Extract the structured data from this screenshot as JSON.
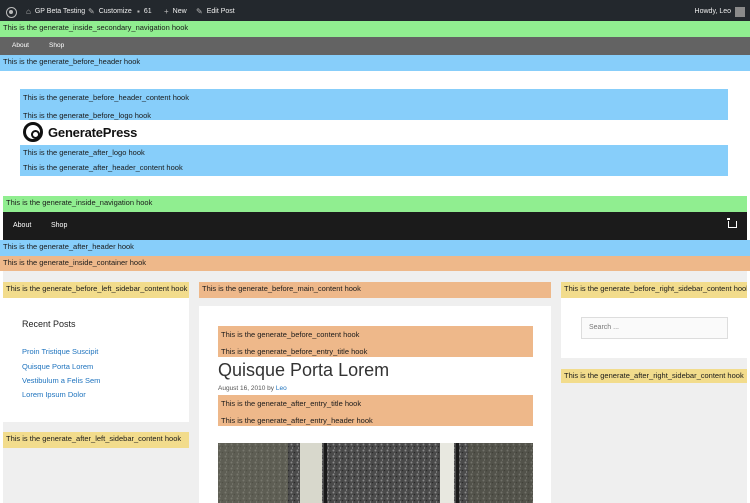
{
  "admin_bar": {
    "site_name": "GP Beta Testing",
    "customize": "Customize",
    "comments_count": "61",
    "new": "New",
    "edit_post": "Edit Post",
    "howdy": "Howdy, Leo"
  },
  "hooks": {
    "inside_secondary_navigation": "This is the generate_inside_secondary_navigation hook",
    "before_header": "This is the generate_before_header hook",
    "before_header_content": "This is the generate_before_header_content hook",
    "before_logo": "This is the generate_before_logo hook",
    "after_logo": "This is the generate_after_logo hook",
    "after_header_content": "This is the generate_after_header_content hook",
    "inside_navigation": "This is the generate_inside_navigation hook",
    "after_header": "This is the generate_after_header hook",
    "inside_container": "This is the generate_inside_container hook",
    "before_left_sidebar_content": "This is the generate_before_left_sidebar_content hook",
    "before_main_content": "This is the generate_before_main_content hook",
    "before_right_sidebar_content": "This is the generate_before_right_sidebar_content hook",
    "before_content": "This is the generate_before_content hook",
    "before_entry_title": "This is the generate_before_entry_title hook",
    "after_entry_title": "This is the generate_after_entry_title hook",
    "after_entry_header": "This is the generate_after_entry_header hook",
    "after_right_sidebar_content": "This is the generate_after_right_sidebar_content hook",
    "after_left_sidebar_content": "This is the generate_after_left_sidebar_content hook"
  },
  "secondary_nav": {
    "items": [
      "About",
      "Shop"
    ]
  },
  "logo": {
    "text": "GeneratePress"
  },
  "main_nav": {
    "items": [
      "About",
      "Shop"
    ]
  },
  "sidebar_left": {
    "title": "Recent Posts",
    "posts": [
      "Proin Tristique Suscipit",
      "Quisque Porta Lorem",
      "Vestibulum a Felis Sem",
      "Lorem Ipsum Dolor"
    ]
  },
  "sidebar_right": {
    "search_placeholder": "Search ..."
  },
  "post": {
    "title": "Quisque Porta Lorem",
    "date": "August 16, 2010",
    "by": "by",
    "author": "Leo"
  },
  "colors": {
    "hook_green": "#90ee90",
    "hook_blue": "#87cefa",
    "hook_orange": "#eeb88a",
    "hook_yellow": "#f2dc8c",
    "admin_bar": "#23282d",
    "navigation": "#1b1b1b",
    "link": "#1e73be"
  }
}
